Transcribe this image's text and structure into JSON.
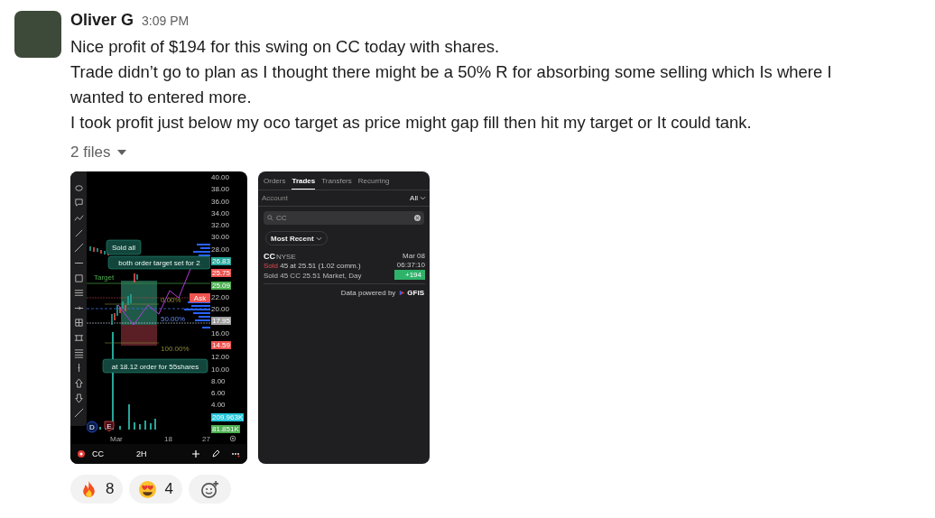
{
  "message": {
    "author": "Oliver G",
    "time": "3:09 PM",
    "paragraphs": [
      "Nice profit of $194 for this swing on CC today with shares.",
      "Trade didn’t go to plan as I thought there might be a 50% R for absorbing some selling which Is where I wanted to entered more.",
      "I took profit just below my oco target as price might gap fill then hit my target or It could tank."
    ],
    "files_label": "2 files"
  },
  "chart_screenshot": {
    "price_axis": [
      {
        "kind": "tick",
        "label": "40.00"
      },
      {
        "kind": "tick",
        "label": "38.00"
      },
      {
        "kind": "tick",
        "label": "36.00"
      },
      {
        "kind": "tick",
        "label": "34.00"
      },
      {
        "kind": "tick",
        "label": "32.00"
      },
      {
        "kind": "tick",
        "label": "30.00"
      },
      {
        "kind": "tick",
        "label": "28.00"
      },
      {
        "kind": "tag",
        "label": "26.83",
        "color": "#26a69a"
      },
      {
        "kind": "tag",
        "label": "25.75",
        "color": "#ef5350"
      },
      {
        "kind": "tag",
        "label": "25.09",
        "color": "#4caf50"
      },
      {
        "kind": "tick",
        "label": "22.00"
      },
      {
        "kind": "tick",
        "label": "20.00"
      },
      {
        "kind": "tag",
        "label": "17.95",
        "color": "#9e9e9e"
      },
      {
        "kind": "tick",
        "label": "16.00"
      },
      {
        "kind": "tag",
        "label": "14.59",
        "color": "#ef5350"
      },
      {
        "kind": "tick",
        "label": "12.00"
      },
      {
        "kind": "tick",
        "label": "10.00"
      },
      {
        "kind": "tick",
        "label": "8.00"
      },
      {
        "kind": "tick",
        "label": "6.00"
      },
      {
        "kind": "tick",
        "label": "4.00"
      },
      {
        "kind": "tag",
        "label": "209.963K",
        "color": "#26c6da"
      },
      {
        "kind": "tag",
        "label": "81.851K",
        "color": "#4caf50"
      }
    ],
    "callouts": [
      "Sold all",
      "both order target set for 2",
      "at 18.12 order for 55shares"
    ],
    "target_label": "Target",
    "ask_label": "Ask",
    "levels": [
      "0.00%",
      "50.00%",
      "100.00%"
    ],
    "markers": [
      "D",
      "E"
    ],
    "x_labels": [
      "Mar",
      "18",
      "27"
    ],
    "symbol": "CC",
    "interval": "2H"
  },
  "trades_screenshot": {
    "tabs": [
      {
        "label": "Orders",
        "selected": false
      },
      {
        "label": "Trades",
        "selected": true
      },
      {
        "label": "Transfers",
        "selected": false
      },
      {
        "label": "Recurring",
        "selected": false
      }
    ],
    "account_label": "Account",
    "account_filter": "All",
    "search": {
      "value": "CC"
    },
    "sort": "Most Recent",
    "trade": {
      "symbol": "CC",
      "exchange": "NYSE",
      "date": "Mar 08",
      "side": "Sold",
      "detail": "45 at 25.51 (1.02 comm.)",
      "time": "06:37:10",
      "description": "Sold 45 CC 25.51 Market, Day",
      "pnl": "+194"
    },
    "footer": "Data powered by",
    "logo": "GFIS"
  },
  "reactions": [
    {
      "kind": "fire",
      "count": "8"
    },
    {
      "kind": "heart_eyes",
      "count": "4"
    }
  ]
}
